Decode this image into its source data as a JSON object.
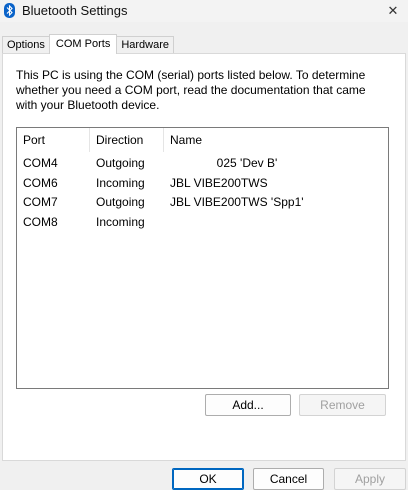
{
  "window": {
    "title": "Bluetooth Settings",
    "icon": "bluetooth-icon",
    "close_glyph": "✕"
  },
  "tabs": [
    {
      "label": "Options"
    },
    {
      "label": "COM Ports",
      "active": true
    },
    {
      "label": "Hardware"
    }
  ],
  "description": "This PC is using the COM (serial) ports listed below. To determine whether you need a COM port, read the documentation that came with your Bluetooth device.",
  "list": {
    "columns": [
      "Port",
      "Direction",
      "Name"
    ],
    "rows": [
      {
        "port": "COM4",
        "direction": "Outgoing",
        "name": "              025 'Dev B'"
      },
      {
        "port": "COM6",
        "direction": "Incoming",
        "name": "JBL VIBE200TWS"
      },
      {
        "port": "COM7",
        "direction": "Outgoing",
        "name": "JBL VIBE200TWS 'Spp1'"
      },
      {
        "port": "COM8",
        "direction": "Incoming",
        "name": ""
      }
    ]
  },
  "buttons": {
    "add": "Add...",
    "remove": "Remove",
    "ok": "OK",
    "cancel": "Cancel",
    "apply": "Apply"
  },
  "colors": {
    "accent": "#0067c0",
    "bluetooth_icon": "#0a63c9"
  }
}
